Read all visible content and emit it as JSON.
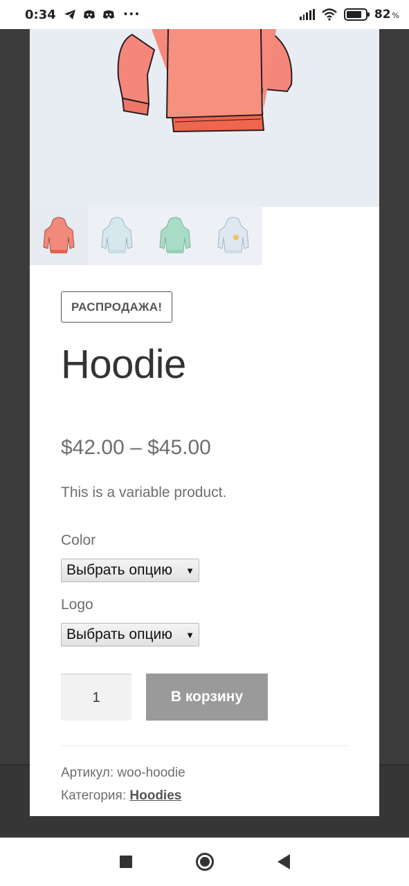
{
  "status_bar": {
    "time": "0:34",
    "left_icons": [
      "telegram-icon",
      "discord-icon",
      "discord-icon"
    ],
    "more": "•••",
    "battery_percent": "82",
    "battery_unit": "%",
    "battery_level": 0.82
  },
  "product": {
    "sale_badge": "РАСПРОДАЖА!",
    "title": "Hoodie",
    "price": "$42.00 – $45.00",
    "description": "This is a variable product.",
    "image_alt": "pink hoodie",
    "thumbnails": [
      {
        "name": "pink hoodie",
        "color": "#f08a7a"
      },
      {
        "name": "light blue hoodie",
        "color": "#d6e7ee"
      },
      {
        "name": "green hoodie",
        "color": "#a9dcc6"
      },
      {
        "name": "hoodie with logo",
        "color": "#dde8f0"
      }
    ],
    "attributes": {
      "color_label": "Color",
      "color_value": "Выбрать опцию",
      "logo_label": "Logo",
      "logo_value": "Выбрать опцию"
    },
    "quantity": "1",
    "add_to_cart": "В корзину",
    "sku_label": "Артикул:",
    "sku_value": "woo-hoodie",
    "category_label": "Категория:",
    "category_value": "Hoodies"
  },
  "colors": {
    "accent_button": "#9a9a9a",
    "image_bg": "#e8edf3",
    "hoodie": "#f2806f"
  },
  "nav": {
    "recent": "square-icon",
    "home": "home-circle-icon",
    "back": "back-triangle-icon"
  }
}
